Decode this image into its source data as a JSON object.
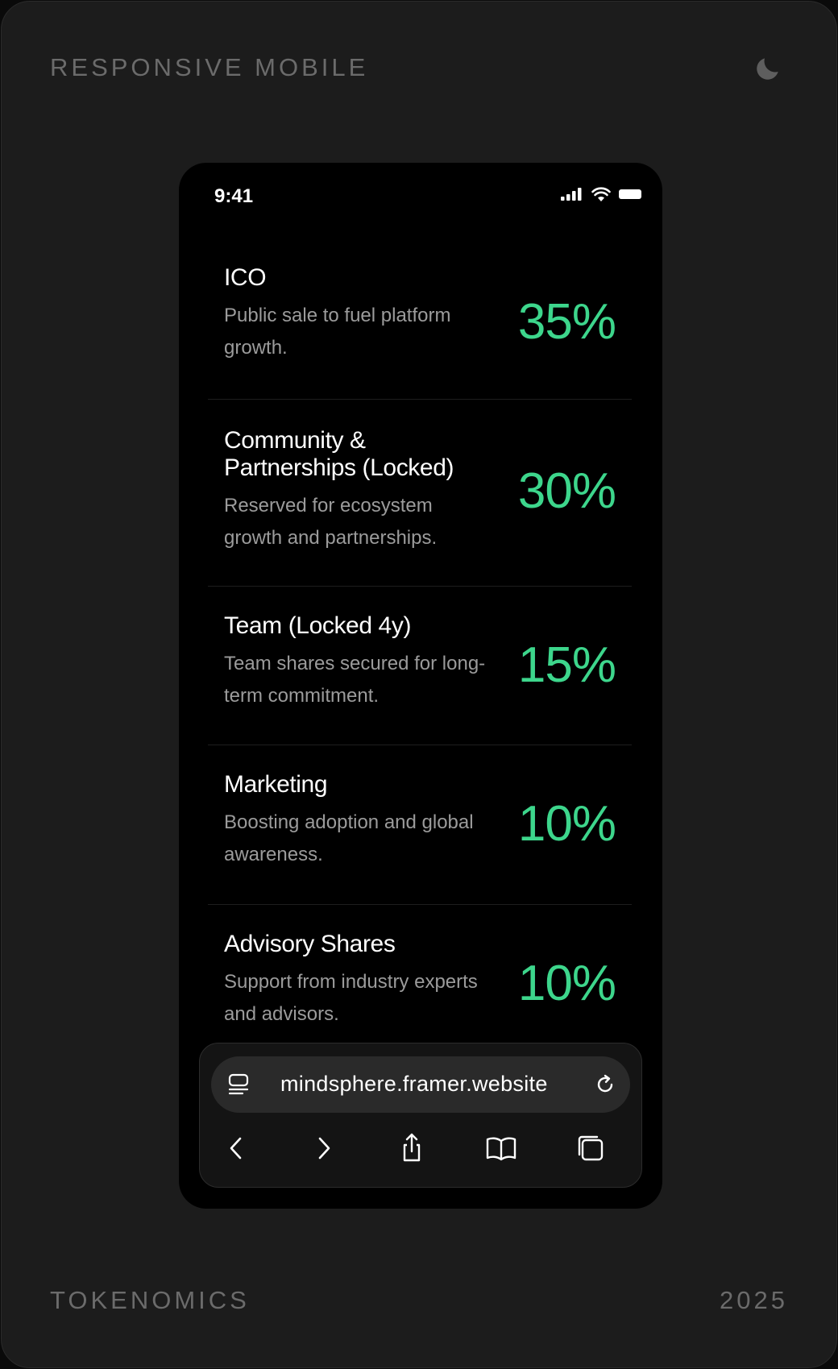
{
  "frame": {
    "top_left_label": "RESPONSIVE MOBILE",
    "bottom_left_label": "TOKENOMICS",
    "bottom_right_label": "2025"
  },
  "status_bar": {
    "time": "9:41"
  },
  "allocations": [
    {
      "title": "ICO",
      "description": "Public sale to fuel platform growth.",
      "percent": "35%"
    },
    {
      "title": "Community & Partnerships (Locked)",
      "description": "Reserved for ecosystem growth and partnerships.",
      "percent": "30%"
    },
    {
      "title": "Team (Locked 4y)",
      "description": "Team shares secured for long-term commitment.",
      "percent": "15%"
    },
    {
      "title": "Marketing",
      "description": "Boosting adoption and global awareness.",
      "percent": "10%"
    },
    {
      "title": "Advisory Shares",
      "description": "Support from industry experts and advisors.",
      "percent": "10%"
    }
  ],
  "browser": {
    "url": "mindsphere.framer.website"
  },
  "colors": {
    "accent": "#3dd68c",
    "background": "#1c1c1c",
    "phone": "#000000"
  }
}
